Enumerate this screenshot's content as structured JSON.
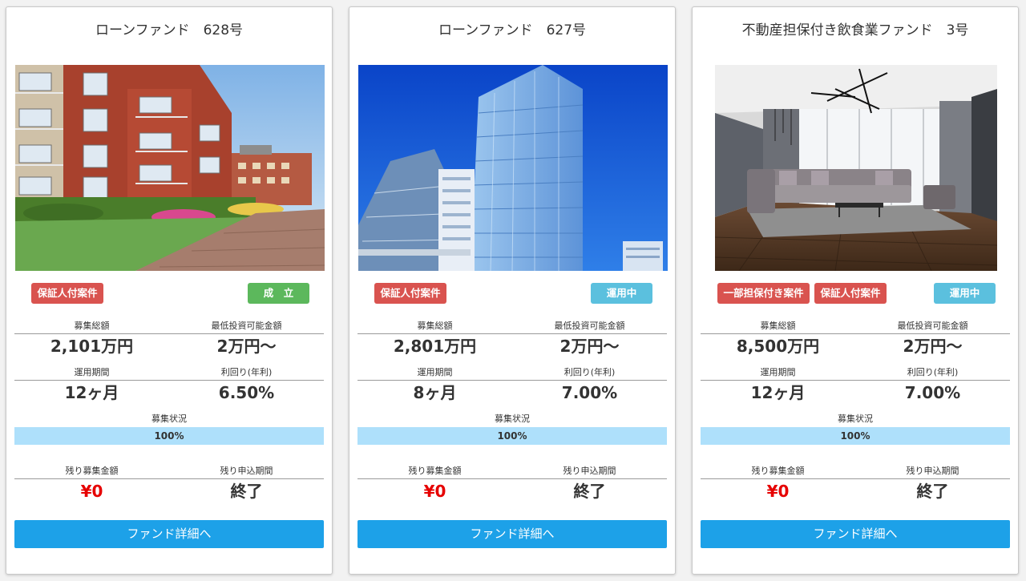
{
  "funds": [
    {
      "title": "ローンファンド　628号",
      "badges": [
        {
          "label": "保証人付案件",
          "color": "red"
        },
        {
          "label": "成　立",
          "color": "green"
        }
      ],
      "stats": {
        "total_label": "募集総額",
        "total_value": "2,101万円",
        "min_label": "最低投資可能金額",
        "min_value": "2万円〜",
        "period_label": "運用期間",
        "period_value": "12ヶ月",
        "yield_label": "利回り(年利)",
        "yield_value": "6.50%"
      },
      "progress": {
        "label": "募集状況",
        "percent_text": "100%",
        "percent": 100
      },
      "remaining": {
        "amount_label": "残り募集金額",
        "amount_value": "¥0",
        "period_label": "残り申込期間",
        "period_value": "終了"
      },
      "button_label": "ファンド詳細へ"
    },
    {
      "title": "ローンファンド　627号",
      "badges": [
        {
          "label": "保証人付案件",
          "color": "red"
        },
        {
          "label": "運用中",
          "color": "cyan"
        }
      ],
      "stats": {
        "total_label": "募集総額",
        "total_value": "2,801万円",
        "min_label": "最低投資可能金額",
        "min_value": "2万円〜",
        "period_label": "運用期間",
        "period_value": "8ヶ月",
        "yield_label": "利回り(年利)",
        "yield_value": "7.00%"
      },
      "progress": {
        "label": "募集状況",
        "percent_text": "100%",
        "percent": 100
      },
      "remaining": {
        "amount_label": "残り募集金額",
        "amount_value": "¥0",
        "period_label": "残り申込期間",
        "period_value": "終了"
      },
      "button_label": "ファンド詳細へ"
    },
    {
      "title": "不動産担保付き飲食業ファンド　3号",
      "badges": [
        {
          "label": "一部担保付き案件",
          "color": "red"
        },
        {
          "label": "保証人付案件",
          "color": "red"
        },
        {
          "label": "運用中",
          "color": "cyan"
        }
      ],
      "stats": {
        "total_label": "募集総額",
        "total_value": "8,500万円",
        "min_label": "最低投資可能金額",
        "min_value": "2万円〜",
        "period_label": "運用期間",
        "period_value": "12ヶ月",
        "yield_label": "利回り(年利)",
        "yield_value": "7.00%"
      },
      "progress": {
        "label": "募集状況",
        "percent_text": "100%",
        "percent": 100
      },
      "remaining": {
        "amount_label": "残り募集金額",
        "amount_value": "¥0",
        "period_label": "残り申込期間",
        "period_value": "終了"
      },
      "button_label": "ファンド詳細へ"
    }
  ],
  "colors": {
    "badge_red": "#d9534f",
    "badge_green": "#5cb85c",
    "badge_cyan": "#5bc0de",
    "button": "#1da1e8",
    "progress_fill": "#aee0fb",
    "remaining_amount": "#e60000"
  }
}
